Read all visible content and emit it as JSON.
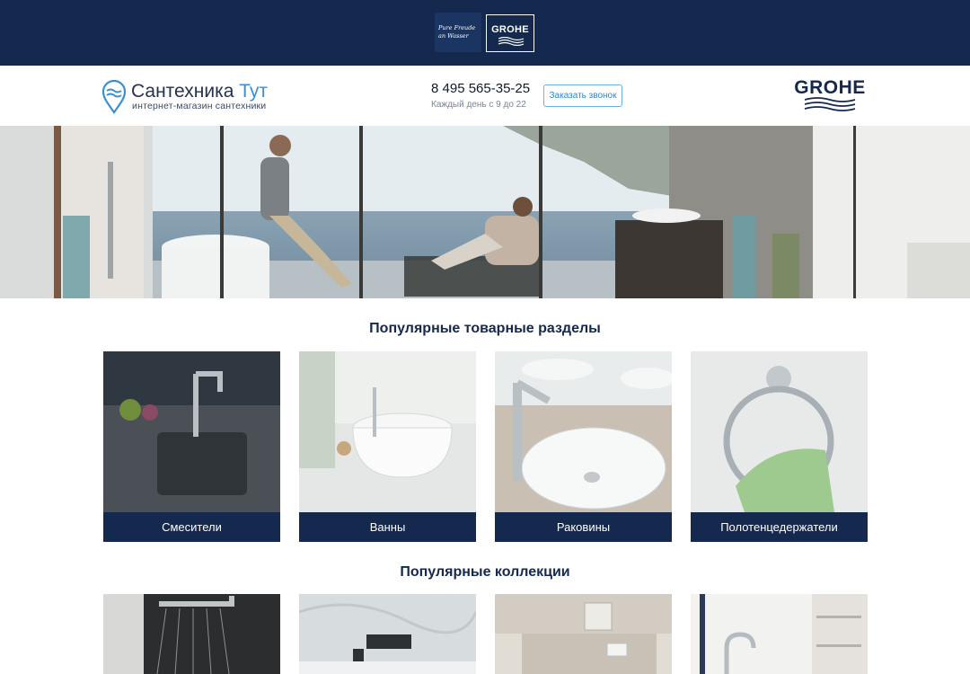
{
  "topband": {
    "slogan": "Pure Freude an Wasser",
    "brand": "GROHE"
  },
  "header": {
    "logo": {
      "name_main": "Сантехника",
      "name_accent": "Тут",
      "subtitle": "интернет-магазин сантехники"
    },
    "phone": "8 495 565-35-25",
    "hours": "Каждый день с 9 до 22",
    "callback_label": "Заказать звонок",
    "brand": "GROHE"
  },
  "popular_sections": {
    "title": "Популярные товарные разделы",
    "items": [
      {
        "label": "Смесители",
        "icon": "kitchen-sink-photo"
      },
      {
        "label": "Ванны",
        "icon": "bathtub-photo"
      },
      {
        "label": "Раковины",
        "icon": "washbasin-photo"
      },
      {
        "label": "Полотенцедержатели",
        "icon": "towel-ring-photo"
      }
    ]
  },
  "popular_collections": {
    "title": "Популярные коллекции"
  },
  "colors": {
    "navy": "#14294d",
    "accent_blue": "#3a8fd1",
    "button_border": "#6cb0e6"
  }
}
